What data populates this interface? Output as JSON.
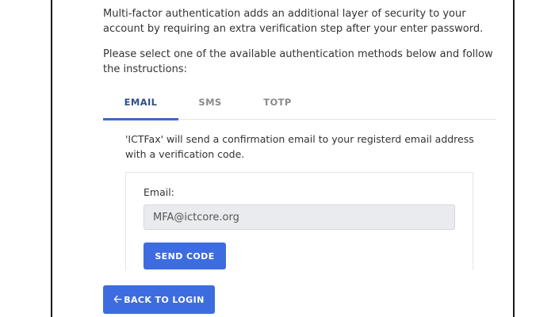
{
  "mfa": {
    "intro": "Multi-factor authentication adds an additional layer of security to your account by requiring an extra verification step after your enter password.",
    "instructions": "Please select one of the available authentication methods below and follow the instructions:"
  },
  "tabs": [
    {
      "label": "EMAIL",
      "active": true
    },
    {
      "label": "SMS",
      "active": false
    },
    {
      "label": "TOTP",
      "active": false
    }
  ],
  "email_panel": {
    "description": "'ICTFax' will send a confirmation email to your registerd email address with a verification code.",
    "email_label": "Email:",
    "email_value": "MFA@ictcore.org",
    "send_button": "SEND CODE"
  },
  "back_button": {
    "icon": "arrow-left-icon",
    "label": "BACK TO LOGIN"
  },
  "colors": {
    "accent": "#3d6ce0",
    "active_tab_text": "#2e4f8c",
    "inactive_tab_text": "#8a8a8a",
    "input_bg": "#e9ebee"
  }
}
